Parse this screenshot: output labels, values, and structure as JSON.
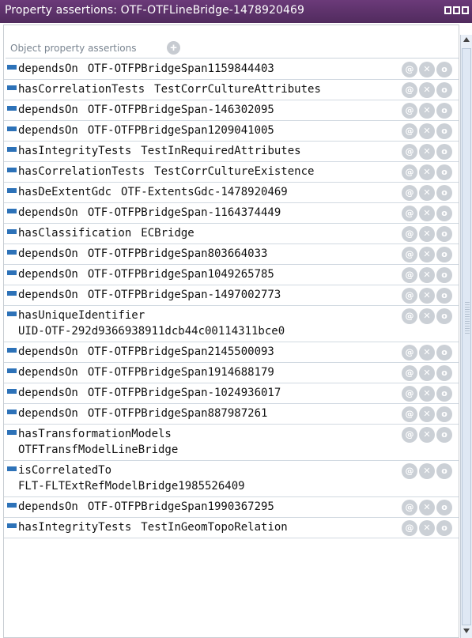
{
  "window": {
    "title": "Property assertions: OTF-OTFLineBridge-1478920469"
  },
  "header": {
    "label": "Object property assertions",
    "add_icon": "plus-circle-icon"
  },
  "row_action_icons": [
    "annotate-icon",
    "delete-icon",
    "edit-icon"
  ],
  "row_action_glyphs": [
    "@",
    "✕",
    "o"
  ],
  "assertions": [
    {
      "property": "dependsOn",
      "value": "OTF-OTFPBridgeSpan1159844403"
    },
    {
      "property": "hasCorrelationTests",
      "value": "TestCorrCultureAttributes"
    },
    {
      "property": "dependsOn",
      "value": "OTF-OTFPBridgeSpan-146302095"
    },
    {
      "property": "dependsOn",
      "value": "OTF-OTFPBridgeSpan1209041005"
    },
    {
      "property": "hasIntegrityTests",
      "value": "TestInRequiredAttributes"
    },
    {
      "property": "hasCorrelationTests",
      "value": "TestCorrCultureExistence"
    },
    {
      "property": "hasDeExtentGdc",
      "value": "OTF-ExtentsGdc-1478920469"
    },
    {
      "property": "dependsOn",
      "value": "OTF-OTFPBridgeSpan-1164374449"
    },
    {
      "property": "hasClassification",
      "value": "ECBridge"
    },
    {
      "property": "dependsOn",
      "value": "OTF-OTFPBridgeSpan803664033"
    },
    {
      "property": "dependsOn",
      "value": "OTF-OTFPBridgeSpan1049265785"
    },
    {
      "property": "dependsOn",
      "value": "OTF-OTFPBridgeSpan-1497002773"
    },
    {
      "property": "hasUniqueIdentifier",
      "value": "UID-OTF-292d9366938911dcb44c00114311bce0",
      "wrap": true
    },
    {
      "property": "dependsOn",
      "value": "OTF-OTFPBridgeSpan2145500093"
    },
    {
      "property": "dependsOn",
      "value": "OTF-OTFPBridgeSpan1914688179"
    },
    {
      "property": "dependsOn",
      "value": "OTF-OTFPBridgeSpan-1024936017"
    },
    {
      "property": "dependsOn",
      "value": "OTF-OTFPBridgeSpan887987261"
    },
    {
      "property": "hasTransformationModels",
      "value": "OTFTransfModelLineBridge",
      "wrap": true
    },
    {
      "property": "isCorrelatedTo",
      "value": "FLT-FLTExtRefModelBridge1985526409",
      "wrap": true
    },
    {
      "property": "dependsOn",
      "value": "OTF-OTFPBridgeSpan1990367295"
    },
    {
      "property": "hasIntegrityTests",
      "value": "TestInGeomTopoRelation"
    }
  ],
  "colors": {
    "titlebar": "#5d3269",
    "property_marker": "#2d72b8",
    "action_button": "#cbd0d6"
  }
}
